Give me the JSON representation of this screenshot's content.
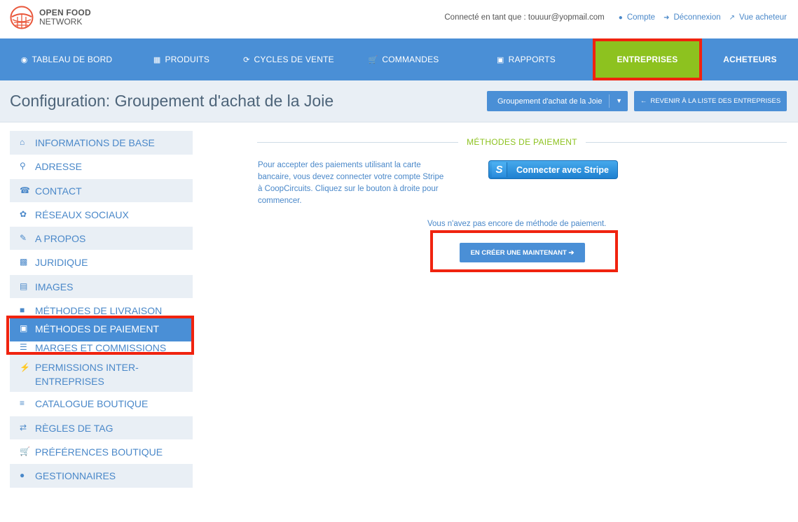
{
  "brand": {
    "line1": "OPEN FOOD",
    "line2": "NETWORK"
  },
  "user": {
    "logged_in_as": "Connecté en tant que : touuur@yopmail.com",
    "account": "Compte",
    "logout": "Déconnexion",
    "shop_view": "Vue acheteur"
  },
  "nav": {
    "dashboard": "TABLEAU DE BORD",
    "products": "PRODUITS",
    "cycles": "CYCLES DE VENTE",
    "orders": "COMMANDES",
    "reports": "RAPPORTS",
    "enterprises": "ENTREPRISES",
    "customers": "ACHETEURS"
  },
  "config": {
    "title": "Configuration: Groupement d'achat de la Joie",
    "enterprise_select": "Groupement d'achat de la Joie",
    "back_button": "REVENIR À LA LISTE DES ENTREPRISES"
  },
  "sidebar": {
    "items": [
      {
        "label": "INFORMATIONS DE BASE",
        "icon": "home-icon"
      },
      {
        "label": "ADRESSE",
        "icon": "map-marker-icon"
      },
      {
        "label": "CONTACT",
        "icon": "phone-icon"
      },
      {
        "label": "RÉSEAUX SOCIAUX",
        "icon": "twitter-icon"
      },
      {
        "label": "A PROPOS",
        "icon": "pencil-icon"
      },
      {
        "label": "JURIDIQUE",
        "icon": "briefcase-icon"
      },
      {
        "label": "IMAGES",
        "icon": "picture-icon"
      },
      {
        "label": "MÉTHODES DE LIVRAISON",
        "icon": "truck-icon"
      },
      {
        "label": "MÉTHODES DE PAIEMENT",
        "icon": "money-icon"
      },
      {
        "label": "MARGES ET COMMISSIONS",
        "icon": "list-icon"
      },
      {
        "label": "PERMISSIONS INTER-ENTREPRISES",
        "icon": "plug-icon"
      },
      {
        "label": "CATALOGUE BOUTIQUE",
        "icon": "list-ol-icon"
      },
      {
        "label": "RÈGLES DE TAG",
        "icon": "random-icon"
      },
      {
        "label": "PRÉFÉRENCES BOUTIQUE",
        "icon": "cart-icon"
      },
      {
        "label": "GESTIONNAIRES",
        "icon": "user-icon"
      }
    ]
  },
  "main": {
    "section_title": "MÉTHODES DE PAIEMENT",
    "info_text": "Pour accepter des paiements utilisant la carte bancaire, vous devez connecter votre compte Stripe à CoopCircuits. Cliquez sur le bouton à droite pour commencer.",
    "stripe_button": "Connecter avec Stripe",
    "stripe_letter": "S",
    "no_payment_text": "Vous n'avez pas encore de méthode de paiement.",
    "create_button": "EN CRÉER UNE MAINTENANT ➔"
  },
  "colors": {
    "nav_bg": "#4a8fd6",
    "active_tab": "#8dc21f",
    "highlight_box": "#f0230f",
    "link": "#4a88c9"
  }
}
